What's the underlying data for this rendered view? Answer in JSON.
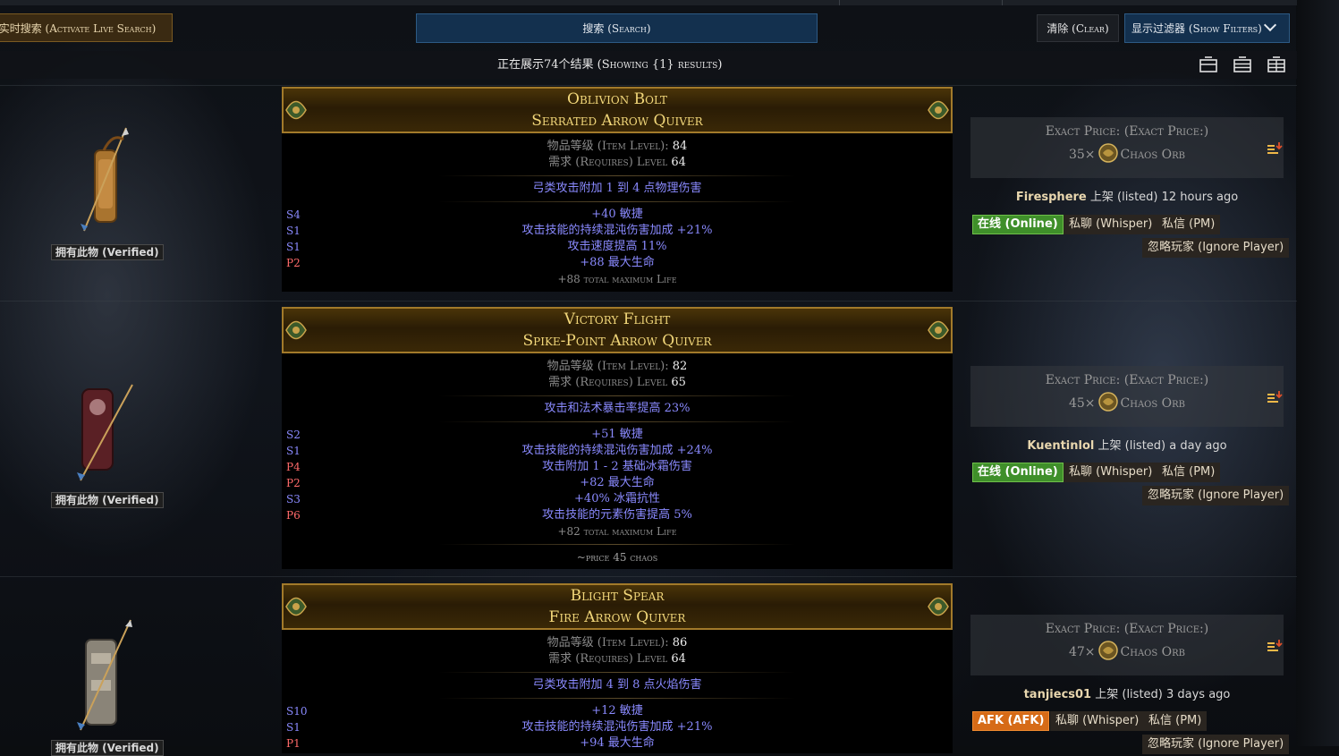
{
  "toolbar": {
    "live_search": "实时搜索 (Activate Live Search)",
    "search": "搜索 (Search)",
    "clear": "清除 (Clear)",
    "show_filters": "显示过滤器 (Show Filters)"
  },
  "results": {
    "summary": "正在展示74个结果 (Showing {1} results)"
  },
  "colors": {
    "accent_blue": "#13304e",
    "item_name": "#f2d77a",
    "mod_blue": "#8a8aff",
    "prefix_red": "#ff6a6a",
    "online_green": "#3f8f2a",
    "afk_orange": "#d66b17"
  },
  "icons": [
    "layout-compact-icon",
    "layout-list-icon",
    "layout-detail-icon",
    "chaos-orb-icon",
    "sort-icon",
    "chevron-down-icon"
  ],
  "listings": [
    {
      "verified": "拥有此物 (Verified)",
      "name": "Oblivion Bolt",
      "base": "Serrated Arrow Quiver",
      "item_level_label": "物品等级 (Item Level): ",
      "item_level": "84",
      "requires_label": "需求 (Requires) Level ",
      "requires_level": "64",
      "implicit": "弓类攻击附加 1 到 4 点物理伤害",
      "mods": [
        {
          "tier": "S4",
          "text": "+40 敏捷"
        },
        {
          "tier": "S1",
          "text": "攻击技能的持续混沌伤害加成 +21%"
        },
        {
          "tier": "S1",
          "text": "攻击速度提高 11%"
        },
        {
          "tier": "P2",
          "text": "+88 最大生命"
        }
      ],
      "pseudo": "+88 total maximum Life",
      "note": "",
      "price_label": "Exact Price: (Exact Price:)",
      "price_amount": "35×",
      "currency": "Chaos Orb",
      "seller": "Firesphere",
      "listed": " 上架 (listed) 12 hours ago",
      "status": "在线 (Online)",
      "whisper": "私聊 (Whisper)",
      "pm": "私信 (PM)",
      "ignore": "忽略玩家 (Ignore Player)"
    },
    {
      "verified": "拥有此物 (Verified)",
      "name": "Victory Flight",
      "base": "Spike-Point Arrow Quiver",
      "item_level_label": "物品等级 (Item Level): ",
      "item_level": "82",
      "requires_label": "需求 (Requires) Level ",
      "requires_level": "65",
      "implicit": "攻击和法术暴击率提高 23%",
      "mods": [
        {
          "tier": "S2",
          "text": "+51 敏捷"
        },
        {
          "tier": "S1",
          "text": "攻击技能的持续混沌伤害加成 +24%"
        },
        {
          "tier": "P4",
          "text": "攻击附加 1 - 2 基础冰霜伤害"
        },
        {
          "tier": "P2",
          "text": "+82 最大生命"
        },
        {
          "tier": "S3",
          "text": "+40% 冰霜抗性"
        },
        {
          "tier": "P6",
          "text": "攻击技能的元素伤害提高 5%"
        }
      ],
      "pseudo": "+82 total maximum Life",
      "note": "~price 45 chaos",
      "price_label": "Exact Price: (Exact Price:)",
      "price_amount": "45×",
      "currency": "Chaos Orb",
      "seller": "Kuentinlol",
      "listed": " 上架 (listed) a day ago",
      "status": "在线 (Online)",
      "whisper": "私聊 (Whisper)",
      "pm": "私信 (PM)",
      "ignore": "忽略玩家 (Ignore Player)"
    },
    {
      "verified": "拥有此物 (Verified)",
      "name": "Blight Spear",
      "base": "Fire Arrow Quiver",
      "item_level_label": "物品等级 (Item Level): ",
      "item_level": "86",
      "requires_label": "需求 (Requires) Level ",
      "requires_level": "64",
      "implicit": "弓类攻击附加 4 到 8 点火焰伤害",
      "mods": [
        {
          "tier": "S10",
          "text": "+12 敏捷"
        },
        {
          "tier": "S1",
          "text": "攻击技能的持续混沌伤害加成 +21%"
        },
        {
          "tier": "P1",
          "text": "+94 最大生命"
        }
      ],
      "pseudo": "",
      "note": "",
      "price_label": "Exact Price: (Exact Price:)",
      "price_amount": "47×",
      "currency": "Chaos Orb",
      "seller": "tanjiecs01",
      "listed": " 上架 (listed) 3 days ago",
      "status": "AFK (AFK)",
      "whisper": "私聊 (Whisper)",
      "pm": "私信 (PM)",
      "ignore": "忽略玩家 (Ignore Player)"
    }
  ]
}
